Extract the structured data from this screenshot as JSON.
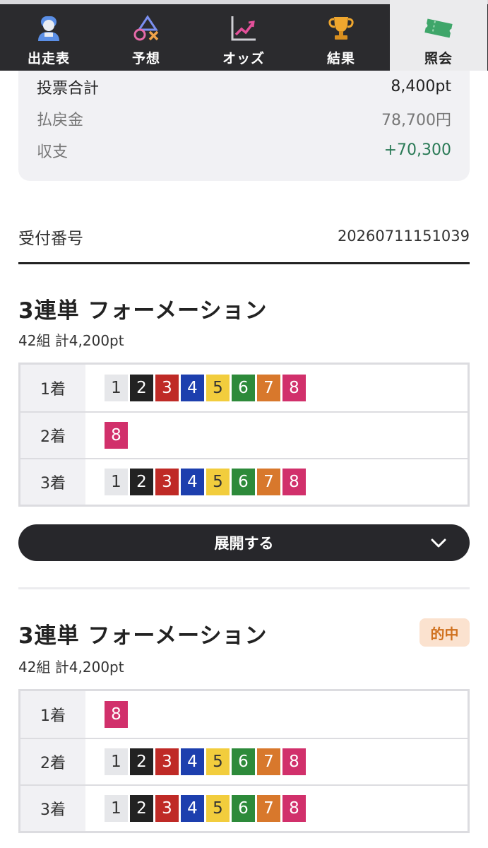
{
  "nav": {
    "items": [
      {
        "label": "出走表",
        "icon": "racer-icon"
      },
      {
        "label": "予想",
        "icon": "prediction-shapes-icon"
      },
      {
        "label": "オッズ",
        "icon": "chart-up-icon"
      },
      {
        "label": "結果",
        "icon": "trophy-icon"
      },
      {
        "label": "照会",
        "icon": "ticket-icon"
      }
    ],
    "active": "照会"
  },
  "summary": {
    "total_label": "投票合計",
    "total_value": "8,400pt",
    "payout_label": "払戻金",
    "payout_value": "78,700円",
    "balance_label": "収支",
    "balance_value": "+70,300"
  },
  "receipt": {
    "label": "受付番号",
    "number": "20260711151039"
  },
  "bets": [
    {
      "title": "3連単 フォーメーション",
      "subtitle": "42組 計4,200pt",
      "rows": [
        {
          "place": "1着",
          "numbers": [
            "1",
            "2",
            "3",
            "4",
            "5",
            "6",
            "7",
            "8"
          ]
        },
        {
          "place": "2着",
          "numbers": [
            "8"
          ]
        },
        {
          "place": "3着",
          "numbers": [
            "1",
            "2",
            "3",
            "4",
            "5",
            "6",
            "7",
            "8"
          ]
        }
      ],
      "expand_label": "展開する"
    },
    {
      "title": "3連単 フォーメーション",
      "subtitle": "42組 計4,200pt",
      "badge": "的中",
      "rows": [
        {
          "place": "1着",
          "numbers": [
            "8"
          ]
        },
        {
          "place": "2着",
          "numbers": [
            "1",
            "2",
            "3",
            "4",
            "5",
            "6",
            "7",
            "8"
          ]
        },
        {
          "place": "3着",
          "numbers": [
            "1",
            "2",
            "3",
            "4",
            "5",
            "6",
            "7",
            "8"
          ]
        }
      ]
    }
  ],
  "colors": {
    "boat_1": "#e6e7ea",
    "boat_2": "#222222",
    "boat_3": "#bf2a26",
    "boat_4": "#1d3fae",
    "boat_5": "#f2cd3d",
    "boat_6": "#2d8a3a",
    "boat_7": "#d8782c",
    "boat_8": "#d1306b",
    "profit": "#2a7a56",
    "hit_badge_text": "#d0711e"
  }
}
